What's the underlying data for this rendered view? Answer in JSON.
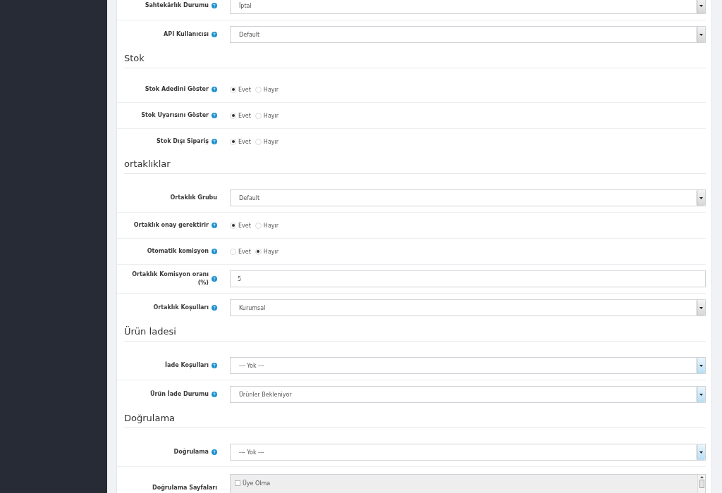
{
  "form": [
    {
      "kind": "select",
      "label": "Sahtekârlık Durumu",
      "help": true,
      "value": "İptal",
      "highlighted": false
    },
    {
      "kind": "select",
      "label": "API Kullanıcısı",
      "help": true,
      "value": "Default",
      "highlighted": false
    },
    {
      "kind": "heading",
      "title": "Stok"
    },
    {
      "kind": "radio",
      "label": "Stok Adedini Göster",
      "help": true,
      "options": [
        {
          "label": "Evet",
          "selected": true
        },
        {
          "label": "Hayır",
          "selected": false
        }
      ]
    },
    {
      "kind": "radio",
      "label": "Stok Uyarısını Göster",
      "help": true,
      "options": [
        {
          "label": "Evet",
          "selected": true
        },
        {
          "label": "Hayır",
          "selected": false
        }
      ]
    },
    {
      "kind": "radio",
      "label": "Stok Dışı Sipariş",
      "help": true,
      "options": [
        {
          "label": "Evet",
          "selected": true
        },
        {
          "label": "Hayır",
          "selected": false
        }
      ]
    },
    {
      "kind": "heading",
      "title": "ortaklıklar"
    },
    {
      "kind": "select",
      "label": "Ortaklık Grubu",
      "help": false,
      "value": "Default",
      "highlighted": false
    },
    {
      "kind": "radio",
      "label": "Ortaklık onay gerektirir",
      "help": true,
      "options": [
        {
          "label": "Evet",
          "selected": true
        },
        {
          "label": "Hayır",
          "selected": false
        }
      ]
    },
    {
      "kind": "radio",
      "label": "Otomatik komisyon",
      "help": true,
      "options": [
        {
          "label": "Evet",
          "selected": false
        },
        {
          "label": "Hayır",
          "selected": true
        }
      ]
    },
    {
      "kind": "input",
      "label": "Ortaklık Komisyon oranı (%)",
      "help": true,
      "value": "5"
    },
    {
      "kind": "select",
      "label": "Ortaklık Koşulları",
      "help": true,
      "value": "Kurumsal",
      "highlighted": false
    },
    {
      "kind": "heading",
      "title": "Ürün İadesi"
    },
    {
      "kind": "select",
      "label": "İade Koşulları",
      "help": true,
      "value": "--- Yok ---",
      "highlighted": true
    },
    {
      "kind": "select",
      "label": "Ürün İade Durumu",
      "help": true,
      "value": "Ürünler Bekleniyor",
      "highlighted": true
    },
    {
      "kind": "heading",
      "title": "Doğrulama"
    },
    {
      "kind": "select",
      "label": "Doğrulama",
      "help": true,
      "value": "--- Yok ---",
      "highlighted": true
    },
    {
      "kind": "listbox",
      "label": "Doğrulama Sayfaları",
      "help": false,
      "items": [
        {
          "label": "Üye Olma",
          "checked": false
        }
      ]
    }
  ]
}
